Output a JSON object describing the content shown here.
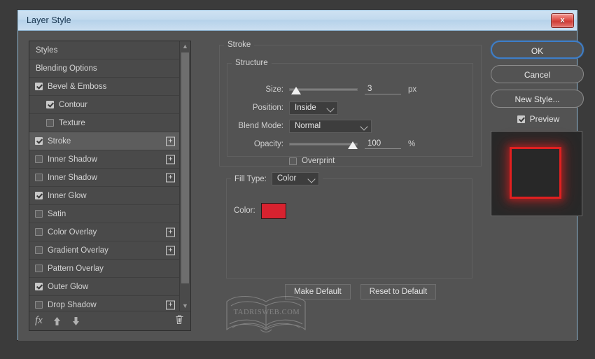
{
  "window": {
    "title": "Layer Style",
    "close_label": "x"
  },
  "styles_panel": {
    "scroll_up": "▲",
    "scroll_down": "▼",
    "items": [
      {
        "label": "Styles",
        "checkbox": "none",
        "indent": false,
        "selected": false,
        "plus": false
      },
      {
        "label": "Blending Options",
        "checkbox": "none",
        "indent": false,
        "selected": false,
        "plus": false
      },
      {
        "label": "Bevel & Emboss",
        "checkbox": "checked",
        "indent": false,
        "selected": false,
        "plus": false
      },
      {
        "label": "Contour",
        "checkbox": "checked",
        "indent": true,
        "selected": false,
        "plus": false
      },
      {
        "label": "Texture",
        "checkbox": "unchecked",
        "indent": true,
        "selected": false,
        "plus": false
      },
      {
        "label": "Stroke",
        "checkbox": "checked",
        "indent": false,
        "selected": true,
        "plus": true
      },
      {
        "label": "Inner Shadow",
        "checkbox": "unchecked",
        "indent": false,
        "selected": false,
        "plus": true
      },
      {
        "label": "Inner Shadow",
        "checkbox": "unchecked",
        "indent": false,
        "selected": false,
        "plus": true
      },
      {
        "label": "Inner Glow",
        "checkbox": "checked",
        "indent": false,
        "selected": false,
        "plus": false
      },
      {
        "label": "Satin",
        "checkbox": "unchecked",
        "indent": false,
        "selected": false,
        "plus": false
      },
      {
        "label": "Color Overlay",
        "checkbox": "unchecked",
        "indent": false,
        "selected": false,
        "plus": true
      },
      {
        "label": "Gradient Overlay",
        "checkbox": "unchecked",
        "indent": false,
        "selected": false,
        "plus": true
      },
      {
        "label": "Pattern Overlay",
        "checkbox": "unchecked",
        "indent": false,
        "selected": false,
        "plus": false
      },
      {
        "label": "Outer Glow",
        "checkbox": "checked",
        "indent": false,
        "selected": false,
        "plus": false
      },
      {
        "label": "Drop Shadow",
        "checkbox": "unchecked",
        "indent": false,
        "selected": false,
        "plus": true
      }
    ],
    "plus_label": "+",
    "footer": {
      "fx_label": "fx",
      "up_label": "⬆",
      "down_label": "⬇",
      "trash_label": "Ὕ1"
    }
  },
  "stroke": {
    "group_title": "Stroke",
    "structure": {
      "group_title": "Structure",
      "size_label": "Size:",
      "size_value": "3",
      "size_unit": "px",
      "size_slider_pct": 3,
      "position_label": "Position:",
      "position_value": "Inside",
      "blend_mode_label": "Blend Mode:",
      "blend_mode_value": "Normal",
      "opacity_label": "Opacity:",
      "opacity_value": "100",
      "opacity_unit": "%",
      "opacity_slider_pct": 100,
      "overprint_label": "Overprint",
      "overprint_checked": false
    },
    "fill": {
      "fill_type_label": "Fill Type:",
      "fill_type_value": "Color",
      "color_label": "Color:",
      "color_hex": "#d8222f"
    },
    "make_default_label": "Make Default",
    "reset_default_label": "Reset to Default"
  },
  "watermark": {
    "text": "TADRISWEB.COM"
  },
  "actions": {
    "ok_label": "OK",
    "cancel_label": "Cancel",
    "new_style_label": "New Style...",
    "preview_label": "Preview",
    "preview_checked": true
  }
}
